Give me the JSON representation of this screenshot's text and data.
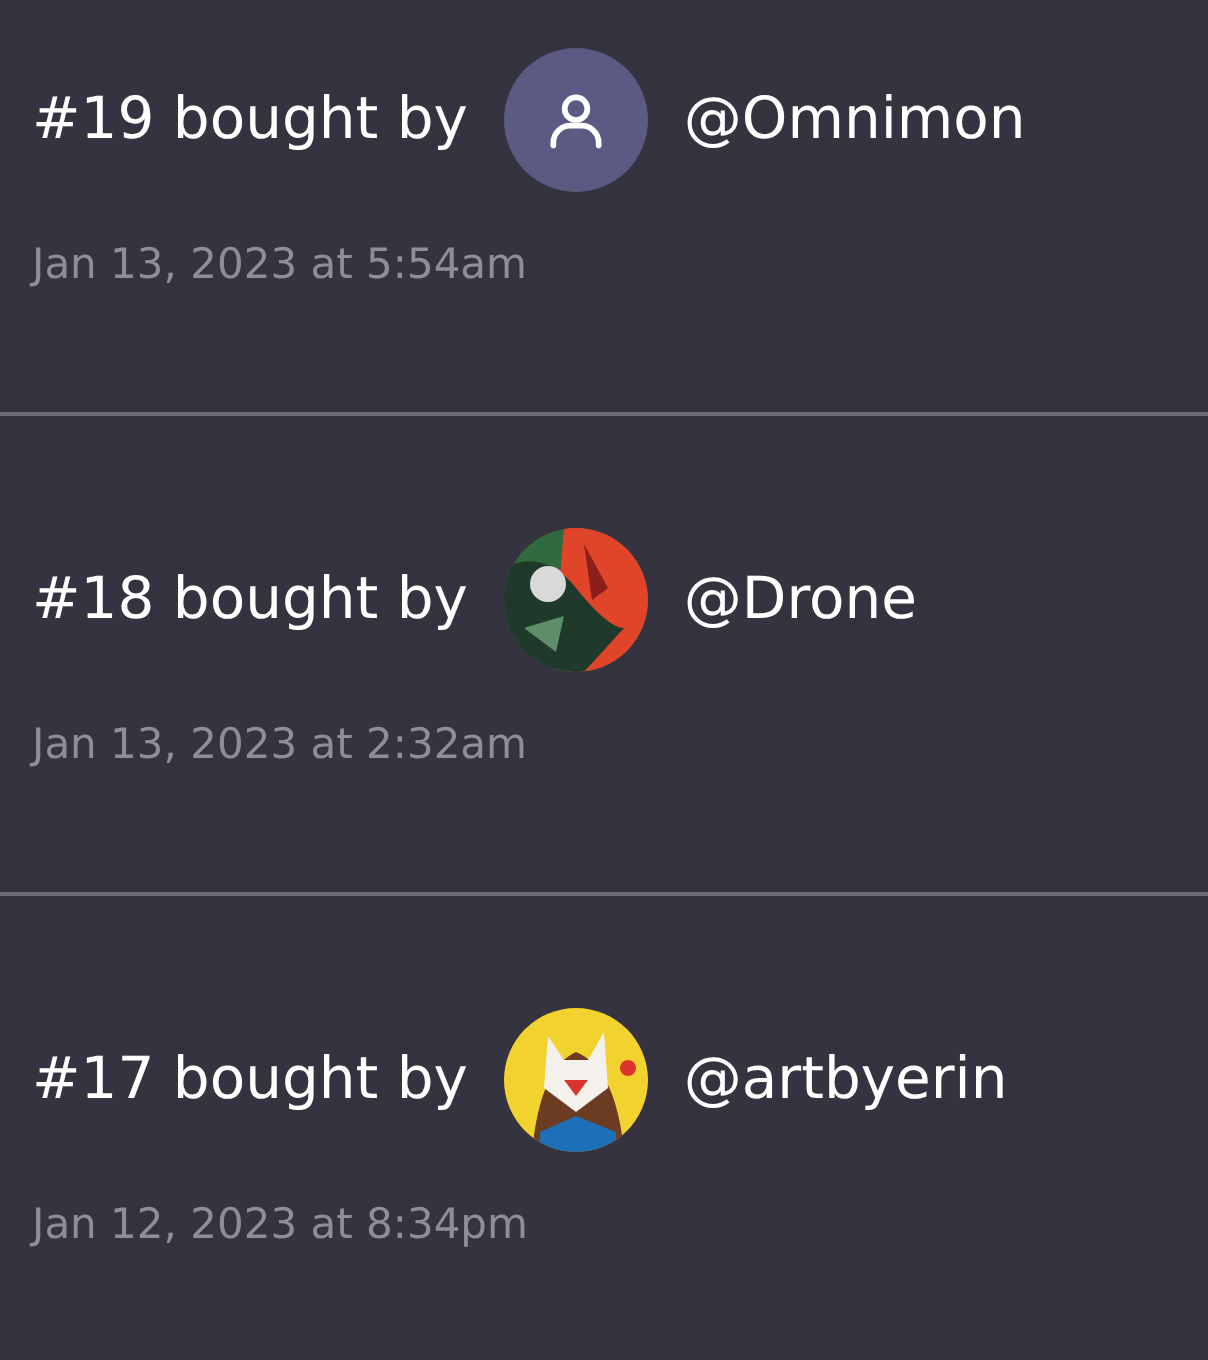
{
  "purchases": [
    {
      "title": "#19 bought by",
      "avatar": {
        "kind": "icon"
      },
      "handle": "@Omnimon",
      "date": "Jan 13, 2023 at 5:54am"
    },
    {
      "title": "#18 bought by",
      "handle": "@Drone",
      "date": "Jan 13, 2023 at 2:32am"
    },
    {
      "title": "#17 bought by",
      "handle": "@artbyerin",
      "date": "Jan 12, 2023 at 8:34pm"
    }
  ]
}
